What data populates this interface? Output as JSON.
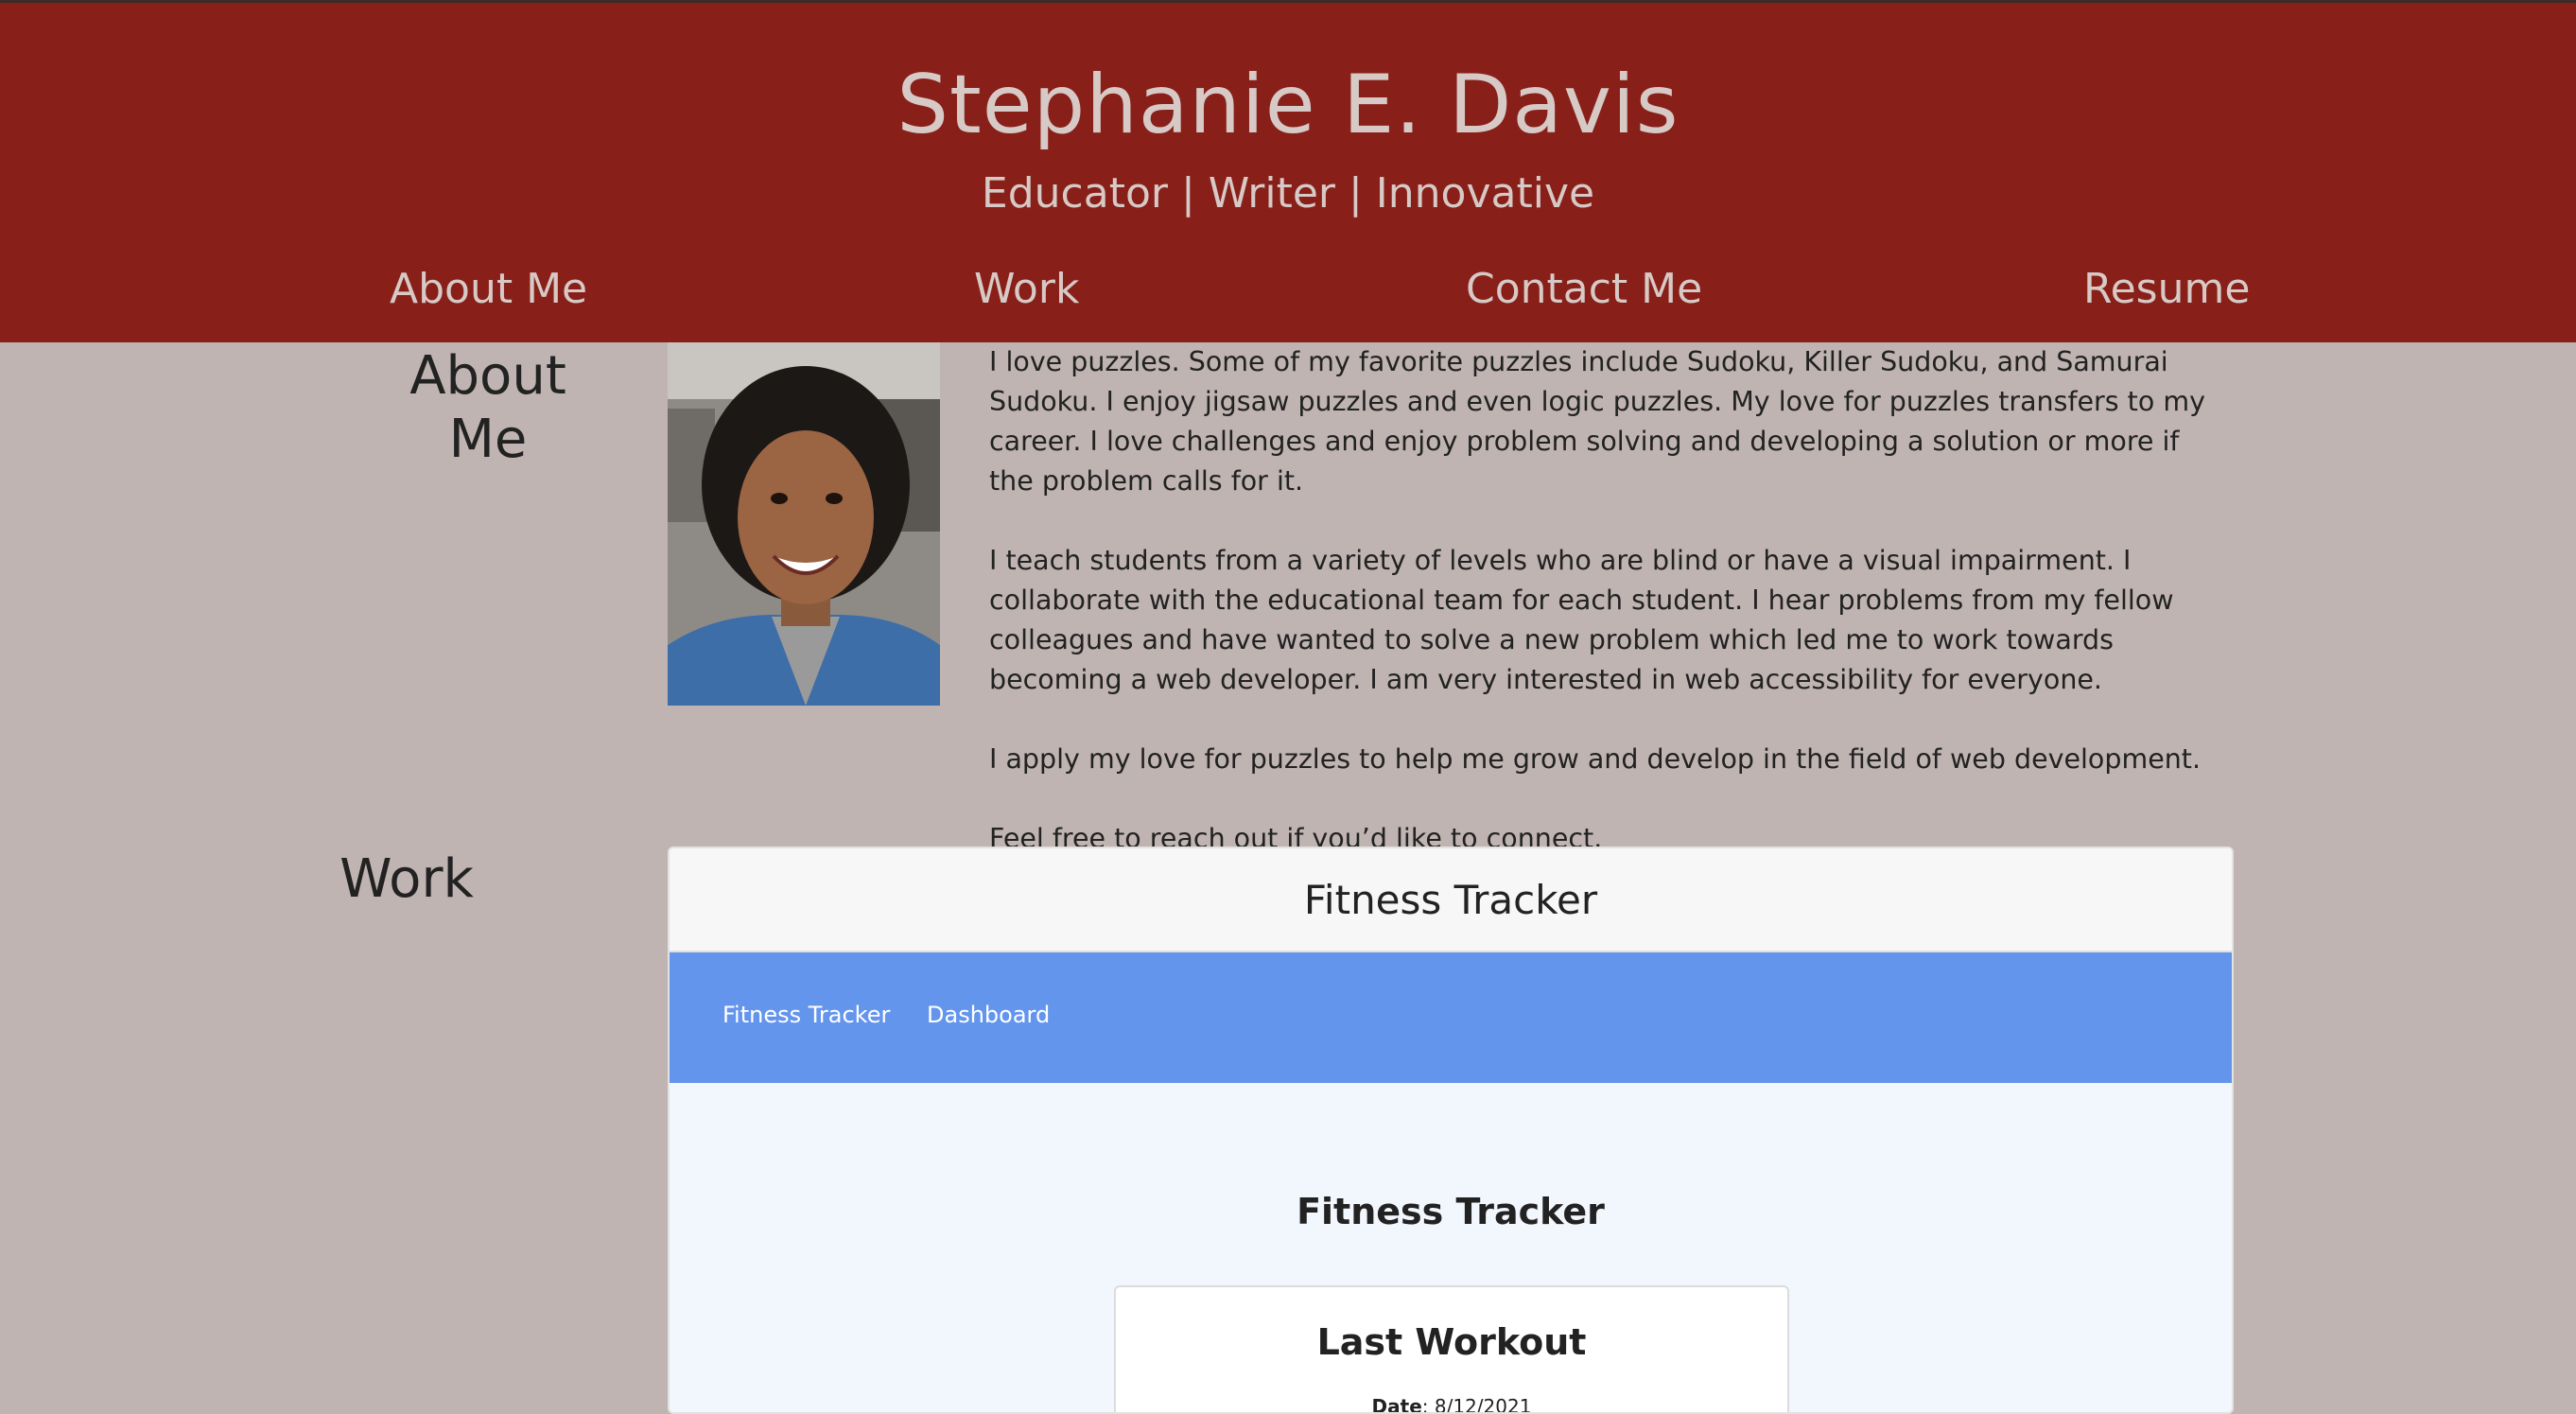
{
  "header": {
    "title": "Stephanie E. Davis",
    "tagline": "Educator | Writer | Innovative"
  },
  "nav": {
    "about": "About Me",
    "work": "Work",
    "contact": "Contact Me",
    "resume": "Resume"
  },
  "about": {
    "heading_line1": "About",
    "heading_line2": "Me",
    "photo_icon": "portrait-photo",
    "paragraphs": [
      "I love puzzles. Some of my favorite puzzles include Sudoku, Killer Sudoku, and Samurai Sudoku. I enjoy jigsaw puzzles and even logic puzzles. My love for puzzles transfers to my career. I love challenges and enjoy problem solving and developing a solution or more if the problem calls for it.",
      "I teach students from a variety of levels who are blind or have a visual impairment. I collaborate with the educational team for each student. I hear problems from my fellow colleagues and have wanted to solve a new problem which led me to work towards becoming a web developer. I am very interested in web accessibility for everyone.",
      "I apply my love for puzzles to help me grow and develop in the field of web development.",
      "Feel free to reach out if you’d like to connect."
    ]
  },
  "work": {
    "heading": "Work",
    "project": {
      "title": "Fitness Tracker",
      "app_nav": [
        "Fitness Tracker",
        "Dashboard"
      ],
      "app_heading": "Fitness Tracker",
      "card_title": "Last Workout",
      "date_label": "Date",
      "date_value": "8/12/2021"
    }
  },
  "colors": {
    "header_bg": "#882019",
    "page_bg": "#bfb4b1",
    "app_nav_bg": "#6495ed",
    "header_text": "#d7c9c6"
  }
}
